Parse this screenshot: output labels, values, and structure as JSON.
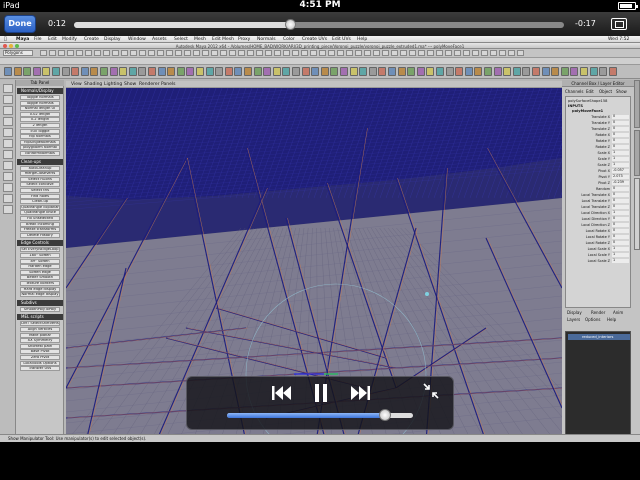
{
  "status_bar": {
    "device": "iPad",
    "time": "4:51 PM",
    "battery_pct": 0.88
  },
  "video": {
    "done_label": "Done",
    "elapsed": "0:12",
    "remaining": "-0:17",
    "progress": 0.44
  },
  "mac": {
    "menus": [
      "Maya",
      "File",
      "Edit",
      "Modify",
      "Create",
      "Display",
      "Window",
      "Assets",
      "Select",
      "Mesh",
      "Edit Mesh",
      "Proxy",
      "Normals",
      "Color",
      "Create UVs",
      "Edit UVs",
      "Help"
    ],
    "clock": "Wed 7:52",
    "window_title": "Autodesk Maya 2012 x64 - /Volumes/HOME_BAD/WORK/ARI/3D_printing_piece/Voronoi_puzzle/voronoi_puzzle_extruded1.ma* --- polyMoveFace1"
  },
  "maya": {
    "mode": "Polygons",
    "view_menu": [
      "View",
      "Shading",
      "Lighting",
      "Show",
      "Renderer",
      "Panels"
    ],
    "left_panel": {
      "title": "Tab Panel",
      "sections": [
        {
          "title": "Normals/Display",
          "items": [
            "Toggle normals",
            "Toggle normals",
            "Normal length UI",
            "0.02 length",
            "0.2 length",
            "2 length",
            "cull Toggle",
            "flip Normals",
            "flipSingleNormals",
            "ploygNorm Normal",
            "conformNormals"
          ]
        },
        {
          "title": "Clean-ups",
          "items": [
            "autoCleanup",
            "mergeCloseVerts",
            "Select nGons",
            "Select concave",
            "Select tris",
            "Find holes",
            "Clean-up",
            "Quadrangle coplanar",
            "Quadrangle brute",
            "Fix unselected",
            "Break incoming",
            "Freeze transforms",
            "Delete History"
          ]
        },
        {
          "title": "Edge Controls",
          "items": [
            "Sel EveryNEdgeLoop",
            "180° Soften",
            "89° Soften",
            "Harden edge",
            "Soften edge",
            "Better Smooth",
            "Texture borders",
            "Hard edge display",
            "Normal edge display"
          ]
        },
        {
          "title": "Subdivs",
          "items": [
            "SmoothPolyToPoly"
          ]
        },
        {
          "title": "MEL scripts",
          "items": [
            "DMT SelectShiftVerts",
            "Align Vertices",
            "Make planar",
            "XX Symmetry",
            "Shortest path",
            "Base Pivot",
            "Zero Pivot",
            "LocalTools Options",
            "Transfer Uvs"
          ]
        }
      ]
    },
    "channel_box": {
      "header": "Channel Box / Layer Editor",
      "menus": [
        "Channels",
        "Edit",
        "Object",
        "Show"
      ],
      "node": "polySurfaceShape158",
      "inputs_label": "INPUTS",
      "input_node": "polyMoveFace1",
      "attributes": [
        {
          "name": "Translate X",
          "value": "0"
        },
        {
          "name": "Translate Y",
          "value": "0"
        },
        {
          "name": "Translate Z",
          "value": "0"
        },
        {
          "name": "Rotate X",
          "value": "0"
        },
        {
          "name": "Rotate Y",
          "value": "0"
        },
        {
          "name": "Rotate Z",
          "value": "0"
        },
        {
          "name": "Scale X",
          "value": "1"
        },
        {
          "name": "Scale Y",
          "value": "1"
        },
        {
          "name": "Scale Z",
          "value": "1"
        },
        {
          "name": "Pivot X",
          "value": "-0.057"
        },
        {
          "name": "Pivot Y",
          "value": "2.073"
        },
        {
          "name": "Pivot Z",
          "value": "-0.239"
        },
        {
          "name": "Random",
          "value": "0"
        },
        {
          "name": "Local Translate X",
          "value": "0"
        },
        {
          "name": "Local Translate Y",
          "value": "0"
        },
        {
          "name": "Local Translate Z",
          "value": "0"
        },
        {
          "name": "Local Direction X",
          "value": "1"
        },
        {
          "name": "Local Direction Y",
          "value": "0"
        },
        {
          "name": "Local Direction Z",
          "value": "0"
        },
        {
          "name": "Local Rotate X",
          "value": "0"
        },
        {
          "name": "Local Rotate Y",
          "value": "0"
        },
        {
          "name": "Local Rotate Z",
          "value": "0"
        },
        {
          "name": "Local Scale X",
          "value": "1"
        },
        {
          "name": "Local Scale Y",
          "value": "1"
        },
        {
          "name": "Local Scale Z",
          "value": "1"
        }
      ],
      "side_tabs": [
        "Attribute Editor",
        "Tool Settings",
        "Channel Box / Layer Editor"
      ]
    },
    "layer_editor": {
      "tabs": [
        "Display",
        "Render",
        "Anim"
      ],
      "menus": [
        "Layers",
        "Options",
        "Help"
      ],
      "layer_name": "reduced_interiors"
    },
    "help_line": "Show Manipulator Tool: Use manipulator(s) to edit selected object(s)."
  },
  "playback": {
    "volume": 0.85
  },
  "colors": {
    "wire": "#1c1c7c",
    "wire_highlight": "#c87850",
    "viewport_bg": "#3a3a5e",
    "done_button": "#2b60c4"
  }
}
